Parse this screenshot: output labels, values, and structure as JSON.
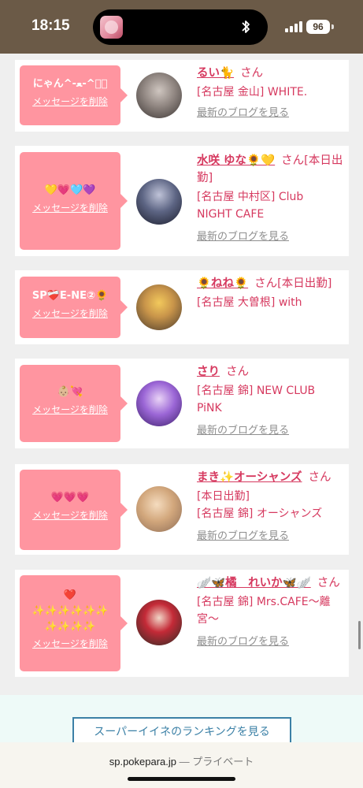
{
  "status_bar": {
    "time": "18:15",
    "battery": "96"
  },
  "bubbles_common": {
    "delete_label": "メッセージを削除"
  },
  "blog_label": "最新のブログを見る",
  "cards": [
    {
      "message": "にゃん^-ﻌ-^ฅ゙",
      "name": "るい🐈",
      "san": "さん",
      "shop_lines": [
        "[名古屋 金山] WHITE."
      ]
    },
    {
      "message": "💛💗🩵💜",
      "name": "水咲 ゆな🌻💛",
      "san": "さん[本日出勤]",
      "shop_lines": [
        "[名古屋 中村区] Club",
        "NIGHT CAFE"
      ]
    },
    {
      "message": "SP❤️‍🩹E-NE②🌻",
      "name": "🌻ねね🌻",
      "san": "さん[本日出勤]",
      "shop_lines": [
        "[名古屋 大曽根] with"
      ]
    },
    {
      "message": "👶🏼💘",
      "name": "さり",
      "san": "さん",
      "shop_lines": [
        "[名古屋 錦] NEW CLUB",
        "PiNK"
      ]
    },
    {
      "message": "💗💗💗",
      "name": "まき✨オーシャンズ",
      "san": "さん",
      "shop_lines": [
        "[本日出勤]",
        "[名古屋 錦] オーシャンズ"
      ]
    },
    {
      "message": "❤️\n✨✨✨✨✨✨\n✨✨✨✨",
      "name": "🪽🦋橘　れいか🦋🪽",
      "san": "さん",
      "shop_lines": [
        "[名古屋 錦] Mrs.CAFE〜離",
        "宮〜"
      ]
    }
  ],
  "ranking_button": "スーパーイイネのランキングを見る",
  "url_bar": {
    "domain": "sp.pokepara.jp",
    "separator": " — ",
    "mode": "プライベート"
  }
}
